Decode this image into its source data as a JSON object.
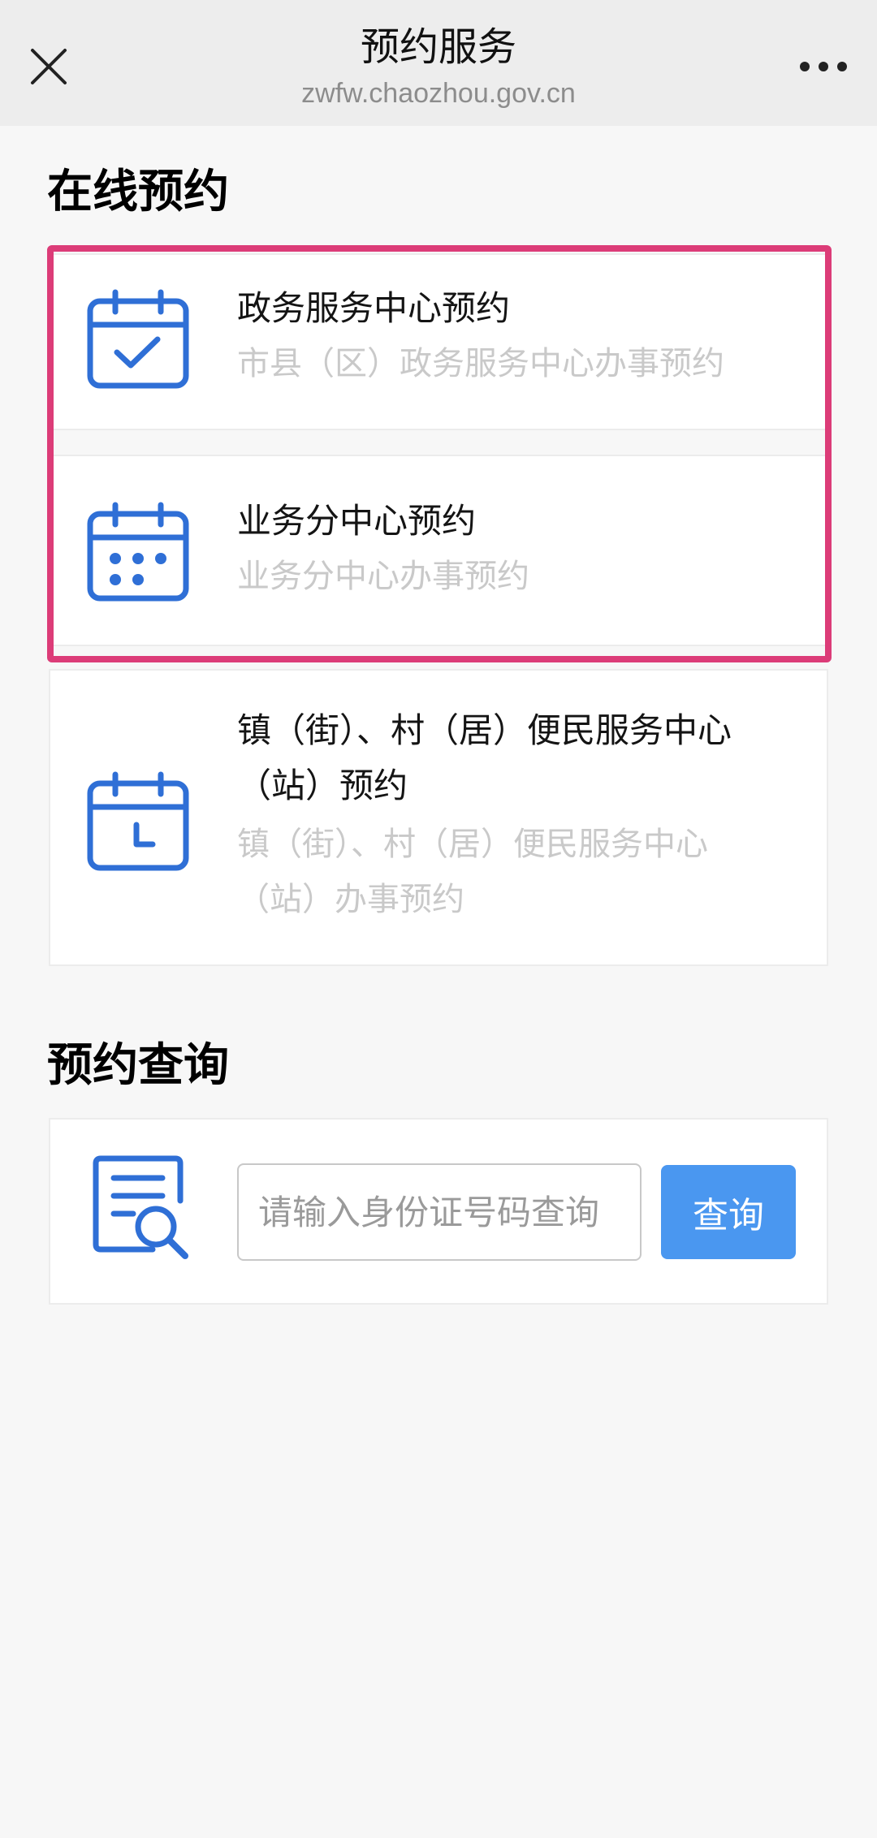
{
  "topbar": {
    "title": "预约服务",
    "url": "zwfw.chaozhou.gov.cn",
    "close_icon": "close-icon",
    "more_icon": "more-icon"
  },
  "online_booking": {
    "heading": "在线预约",
    "items": [
      {
        "title": "政务服务中心预约",
        "desc": "市县（区）政务服务中心办事预约",
        "icon": "calendar-check-icon"
      },
      {
        "title": "业务分中心预约",
        "desc": "业务分中心办事预约",
        "icon": "calendar-dots-icon"
      },
      {
        "title": "镇（街）、村（居）便民服务中心（站）预约",
        "desc": "镇（街）、村（居）便民服务中心（站）办事预约",
        "icon": "calendar-clock-icon"
      }
    ]
  },
  "booking_query": {
    "heading": "预约查询",
    "placeholder": "请输入身份证号码查询",
    "button_label": "查询",
    "icon": "document-search-icon"
  },
  "colors": {
    "accent_blue": "#2f6fd6",
    "button_blue": "#4a97f0",
    "highlight": "#dc3c78",
    "muted_text": "#c9c9c9"
  }
}
